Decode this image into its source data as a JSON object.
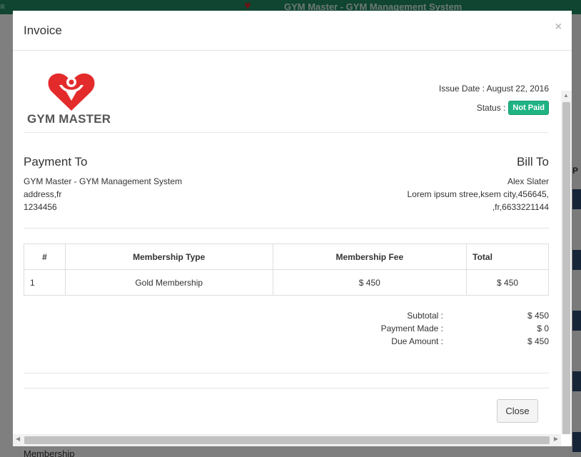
{
  "background": {
    "title": "GYM Master - GYM Management System",
    "side_letter": "P",
    "bottom_text": "Membership"
  },
  "modal": {
    "title": "Invoice",
    "close_icon": "×"
  },
  "invoice": {
    "logo_text": "GYM MASTER",
    "issue_date": "Issue Date : August 22, 2016",
    "status_label": "Status :",
    "status_value": "Not Paid",
    "status_color": "#1fb384",
    "payment_to": {
      "heading": "Payment To",
      "lines": [
        "GYM Master - GYM Management System",
        "address,fr",
        "1234456"
      ]
    },
    "bill_to": {
      "heading": "Bill To",
      "lines": [
        "Alex Slater",
        "Lorem ipsum stree,ksem city,456645,",
        ",fr,6633221144"
      ]
    },
    "table": {
      "headers": [
        "#",
        "Membership Type",
        "Membership Fee",
        "Total"
      ],
      "rows": [
        [
          "1",
          "Gold Membership",
          "$ 450",
          "$ 450"
        ]
      ]
    },
    "totals": [
      {
        "label": "Subtotal :",
        "value": "$ 450"
      },
      {
        "label": "Payment Made :",
        "value": "$ 0"
      },
      {
        "label": "Due Amount :",
        "value": "$ 450"
      }
    ],
    "close_button": "Close"
  }
}
